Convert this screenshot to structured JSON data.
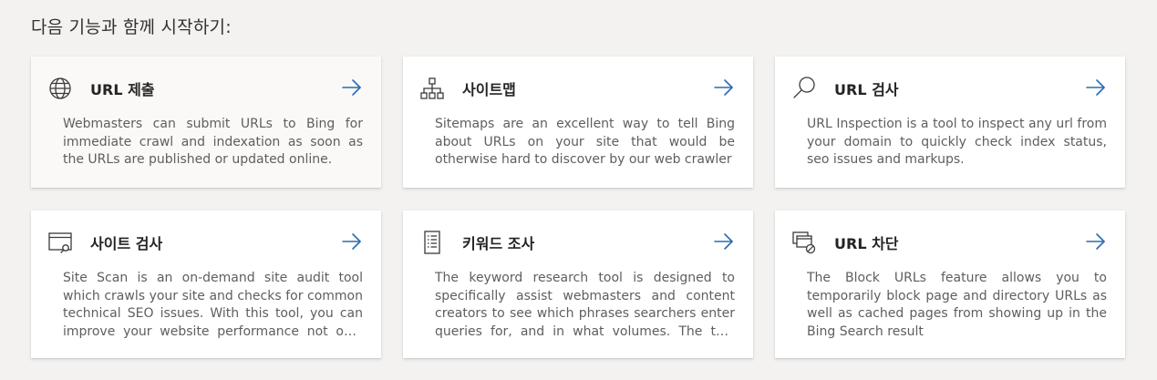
{
  "heading": "다음 기능과 함께 시작하기:",
  "accent_color": "#2b6cb0",
  "cards": [
    {
      "title": "URL 제출",
      "icon": "globe-icon",
      "description": "Webmasters can submit URLs to Bing for immediate crawl and indexation as soon as the URLs are published or updated online."
    },
    {
      "title": "사이트맵",
      "icon": "sitemap-icon",
      "description": "Sitemaps are an excellent way to tell Bing about URLs on your site that would be otherwise hard to discover by our web crawler"
    },
    {
      "title": "URL 검사",
      "icon": "search-icon",
      "description": "URL Inspection is a tool to inspect any url from your domain to quickly check index status, seo issues and markups."
    },
    {
      "title": "사이트 검사",
      "icon": "site-scan-icon",
      "description": "Site Scan is an on-demand site audit tool which crawls your site and checks for common technical SEO issues. With this tool, you can improve your website performance not only on Bing but on.."
    },
    {
      "title": "키워드 조사",
      "icon": "keyword-document-icon",
      "description": "The keyword research tool is designed to specifically assist webmasters and content creators to see which phrases searchers enter queries for, and in what volumes. The tool uses.."
    },
    {
      "title": "URL 차단",
      "icon": "block-urls-icon",
      "description": "The Block URLs feature allows you to temporarily block page and directory URLs as well as cached pages from showing up in the Bing Search result"
    }
  ]
}
